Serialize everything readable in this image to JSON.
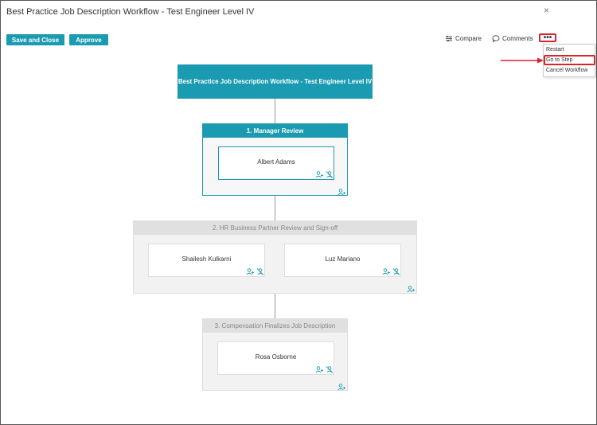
{
  "window": {
    "title": "Best Practice Job Description Workflow - Test Engineer Level IV",
    "close_glyph": "×"
  },
  "toolbar": {
    "save_close_label": "Save and Close",
    "approve_label": "Approve",
    "compare_label": "Compare",
    "comments_label": "Comments",
    "more_glyph": "•••"
  },
  "menu": {
    "items": [
      "Restart",
      "Go to Step",
      "Cancel Workflow"
    ]
  },
  "workflow": {
    "start_label": "Best Practice Job Description Workflow - Test Engineer Level IV",
    "steps": [
      {
        "title": "1. Manager Review",
        "assignees": [
          "Albert Adams"
        ]
      },
      {
        "title": "2. HR Business Partner Review and Sign-off",
        "assignees": [
          "Shailesh Kulkarni",
          "Luz Mariano"
        ]
      },
      {
        "title": "3. Compensation Finalizes Job Description",
        "assignees": [
          "Rosa Osborne"
        ]
      }
    ]
  },
  "colors": {
    "accent": "#1a9bb1",
    "highlight": "#d9232d",
    "inactive_header": "#e0e0e0"
  }
}
